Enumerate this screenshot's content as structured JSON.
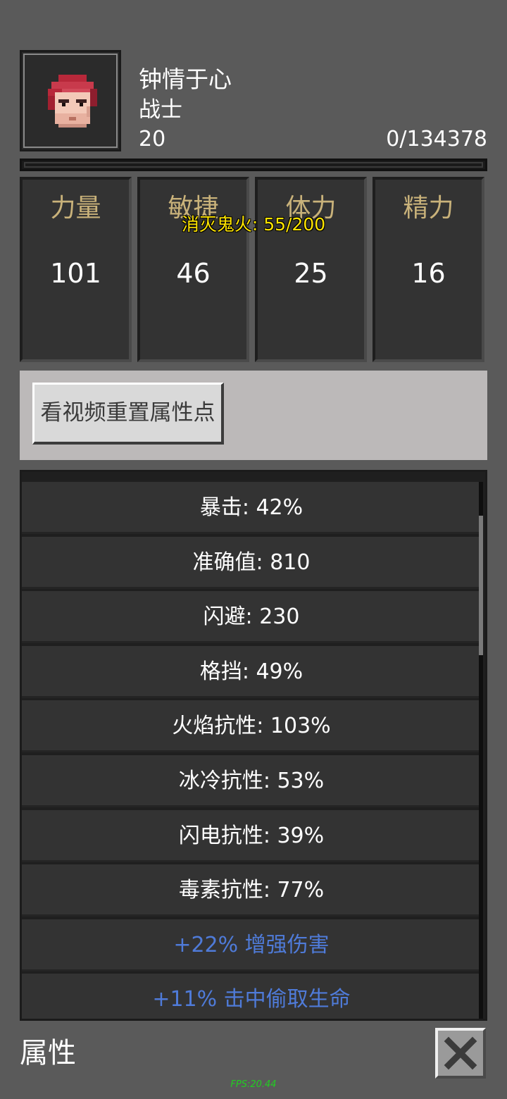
{
  "character": {
    "name": "钟情于心",
    "class": "战士",
    "level": "20",
    "experience": "0/134378",
    "experience_progress": 0.0
  },
  "attributes": [
    {
      "label": "力量",
      "value": "101"
    },
    {
      "label": "敏捷",
      "value": "46"
    },
    {
      "label": "体力",
      "value": "25"
    },
    {
      "label": "精力",
      "value": "16"
    }
  ],
  "quest_tracker": "消灭鬼火: 55/200",
  "reset_button": "看视频重置属性点",
  "stats": [
    "暴击: 42%",
    "准确值: 810",
    "闪避: 230",
    "格挡: 49%",
    "火焰抗性: 103%",
    "冰冷抗性: 53%",
    "闪电抗性: 39%",
    "毒素抗性: 77%",
    "+22% 增强伤害",
    "+11% 击中偷取生命"
  ],
  "bottom_bar": {
    "title": "属性",
    "close_icon": "close-x-icon"
  },
  "fps": "FPS:20.44",
  "colors": {
    "attribute_label": "#c9b27a",
    "quest_text": "#ffe500",
    "bonus_stat": "#4f7bd9",
    "fps_text": "#22cc22"
  }
}
